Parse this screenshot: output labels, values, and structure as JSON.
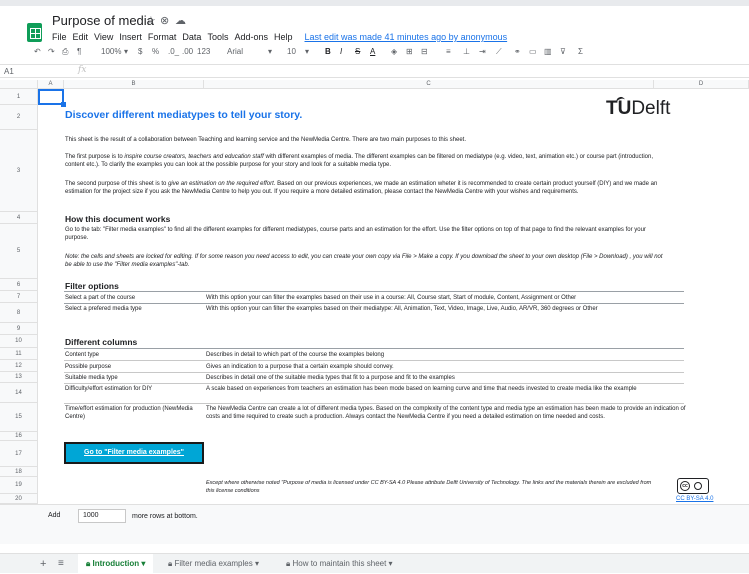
{
  "app": {
    "title": "Purpose of media",
    "icons": [
      "star-icon",
      "move-icon",
      "cloud-icon"
    ],
    "menu": [
      "File",
      "Edit",
      "View",
      "Insert",
      "Format",
      "Data",
      "Tools",
      "Add-ons",
      "Help"
    ],
    "last_edit": "Last edit was made 41 minutes ago by anonymous"
  },
  "toolbar": {
    "zoom": "100%",
    "currency": "$",
    "percent": "%",
    "dec_less": ".0_",
    "dec_more": ".00",
    "format_more": "123",
    "font": "Arial",
    "font_size": "10",
    "bold": "B",
    "italic": "I",
    "strike": "S",
    "text_color": "A"
  },
  "formula": {
    "cell_ref": "A1",
    "fx": "fx",
    "value": ""
  },
  "columns": [
    "A",
    "B",
    "C",
    "D"
  ],
  "rows": [
    "1",
    "2",
    "3",
    "4",
    "5",
    "6",
    "7",
    "8",
    "9",
    "10",
    "11",
    "12",
    "13",
    "14",
    "15",
    "16",
    "17",
    "18",
    "19",
    "20"
  ],
  "content": {
    "heading": "Discover different mediatypes to tell your story.",
    "logo_text": "TU",
    "logo_delft": "Delft",
    "intro": "This sheet is the result of a collaboration between Teaching and learning service and the NewMedia Centre. There are two main purposes to this sheet.",
    "p1_a": "The first purpose is to ",
    "p1_it": "inspire course creators, teachers and education staff",
    "p1_b": " with different examples of media. The different examples can be filtered on mediatype (e.g. video, text, animation etc.) or course part (introduction, content etc.). To clarify the examples you can look at the possible purpose for your story and look for a suitable media type.",
    "p2_a": "The second purpose of this sheet is to ",
    "p2_it": "give an estimation on the required effort",
    "p2_b": ". Based on our  previous experiences, we made an estimation wheter it is recommended to create certain product yourself (DIY) and we made an estimation for the project size if you ask the NewMedia Centre to help you out. If you require a more detailed estimation, please contact the NewMedia Centre with your wishes and requirements.",
    "how_title": "How this document works",
    "how_text": "Go to the tab: \"Filter media examples\" to find all the different examples for different mediatypes, course parts and an estimation for the effort. Use the filter options on top of that page to find the relevant examples for your purpose.",
    "how_note": "Note: the cells and sheets are locked for editing. If for some reason you need access to edit, you can create your own copy via File > Make a copy. If you download the sheet to your own desktop (File > Download) , you will not be able to use the \"Filter media examples\"-tab.",
    "filter_title": "Filter options",
    "filter_rows": [
      {
        "label": "Select a part of the course",
        "desc": "With this option your can filter the examples based on their use in a course: All, Course start, Start of module, Content, Assignment or Other"
      },
      {
        "label": "Select a prefered media type",
        "desc": "With this option your can filter the examples based on their mediatype: All, Animation, Text, Video, Image, Live, Audio, AR/VR, 360 degrees or Other"
      }
    ],
    "columns_title": "Different columns",
    "column_rows": [
      {
        "label": "Content type",
        "desc": "Describes in detail to which part of the course the examples belong"
      },
      {
        "label": "Possible purpose",
        "desc": "Gives an indication to a purpose that a certain example should convey."
      },
      {
        "label": "Suitable media type",
        "desc": "Describes in detail one of the suitable media types that fit to a purpose and fit to the examples"
      },
      {
        "label": "Difficulty/effort estimation for DIY",
        "desc": "A scale based on experiences from teachers an estimation has been mode based on learning curve and time that needs invested to create media like the example"
      },
      {
        "label": "Time/effort estimation for production (NewMedia Centre)",
        "desc": "The NewMedia Centre can create a lot of different media types. Based on the complexity of the content type and media type an estimation has been made to provide an indication of costs and time required to create such a production. Always contact the NewMedia Centre if you need a detailed estimation on time needed and costs."
      }
    ],
    "go_button": "Go to \"Filter media examples\"",
    "license": "Except where otherwise noted \"Purpose of media is licensed under CC BY-SA 4.0 Please attribute Delft University of Technology. The links and the materials therein are excluded from this license conditions",
    "cc_link": "CC BY-SA 4.0"
  },
  "add_rows": {
    "button": "Add",
    "count": "1000",
    "label": "more rows at bottom."
  },
  "tabs": [
    {
      "label": "Introduction",
      "active": true
    },
    {
      "label": "Filter media examples",
      "active": false
    },
    {
      "label": "How to maintain this sheet",
      "active": false
    }
  ]
}
